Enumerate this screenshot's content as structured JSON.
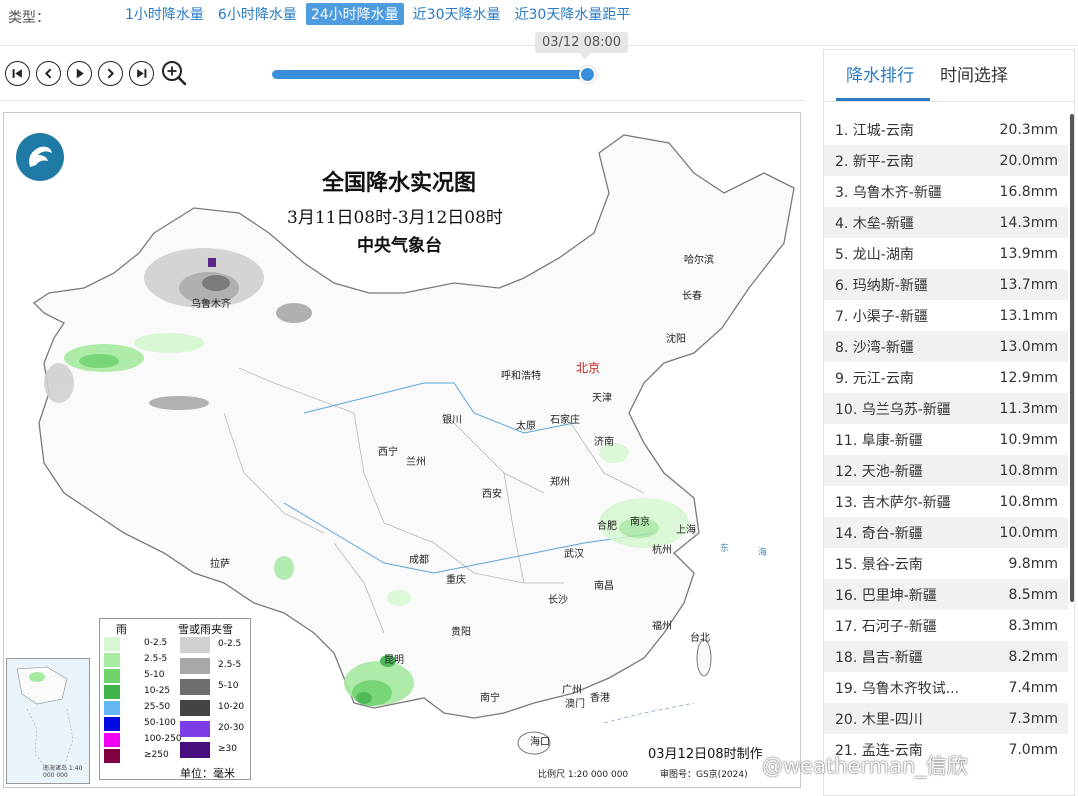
{
  "typebar": {
    "label": "类型：",
    "tabs": [
      "1小时降水量",
      "6小时降水量",
      "24小时降水量",
      "近30天降水量",
      "近30天降水量距平"
    ],
    "active_index": 2
  },
  "player": {
    "time_label": "03/12 08:00",
    "progress": 1.0,
    "controls": [
      "first-frame-icon",
      "prev-frame-icon",
      "play-icon",
      "next-frame-icon",
      "last-frame-icon",
      "zoom-in-icon"
    ]
  },
  "map": {
    "title": "全国降水实况图",
    "subtitle": "3月11日08时-3月12日08时",
    "org": "中央气象台",
    "cities": {
      "urumqi": "乌鲁木齐",
      "harbin": "哈尔滨",
      "changchun": "长春",
      "shenyang": "沈阳",
      "hohhot": "呼和浩特",
      "beijing": "北京",
      "tianjin": "天津",
      "yinchuan": "银川",
      "taiyuan": "太原",
      "shijiazhuang": "石家庄",
      "jinan": "济南",
      "xining": "西宁",
      "lanzhou": "兰州",
      "zhengzhou": "郑州",
      "xian": "西安",
      "hefei": "合肥",
      "nanjing": "南京",
      "shanghai": "上海",
      "hangzhou": "杭州",
      "lhasa": "拉萨",
      "chengdu": "成都",
      "wuhan": "武汉",
      "chongqing": "重庆",
      "nanchang": "南昌",
      "changsha": "长沙",
      "guiyang": "贵阳",
      "fuzhou": "福州",
      "taipei": "台北",
      "kunming": "昆明",
      "guangzhou": "广州",
      "nanning": "南宁",
      "hongkong": "香港",
      "macau": "澳门",
      "haikou": "海口"
    },
    "seas": {
      "east": "东",
      "sea": "海"
    },
    "legend": {
      "rain_header": "雨",
      "snow_header": "雪或雨夹雪",
      "rain_levels": [
        "0-2.5",
        "2.5-5",
        "5-10",
        "10-25",
        "25-50",
        "50-100",
        "100-250",
        "≥250"
      ],
      "rain_colors": [
        "#d7f7d2",
        "#a6e9a0",
        "#6cd36a",
        "#3eb44a",
        "#64b8f2",
        "#0008e0",
        "#f200f2",
        "#800040"
      ],
      "snow_levels": [
        "0-2.5",
        "2.5-5",
        "5-10",
        "10-20",
        "20-30",
        "≥30"
      ],
      "snow_colors": [
        "#d0d0d0",
        "#a8a8a8",
        "#6e6e6e",
        "#444444",
        "#7c3ce6",
        "#4a0f7e"
      ],
      "unit": "单位：毫米"
    },
    "made_time": "03月12日08时制作",
    "scale": "比例尺 1:20 000 000",
    "approval": "审图号：GS京(2024)",
    "inset_text": "南海诸岛 1:40 000 000"
  },
  "panel": {
    "tabs": [
      "降水排行",
      "时间选择"
    ],
    "active_tab": 0,
    "ranking": [
      {
        "name": "1. 江城-云南",
        "value": "20.3mm"
      },
      {
        "name": "2. 新平-云南",
        "value": "20.0mm"
      },
      {
        "name": "3. 乌鲁木齐-新疆",
        "value": "16.8mm"
      },
      {
        "name": "4. 木垒-新疆",
        "value": "14.3mm"
      },
      {
        "name": "5. 龙山-湖南",
        "value": "13.9mm"
      },
      {
        "name": "6. 玛纳斯-新疆",
        "value": "13.7mm"
      },
      {
        "name": "7. 小渠子-新疆",
        "value": "13.1mm"
      },
      {
        "name": "8. 沙湾-新疆",
        "value": "13.0mm"
      },
      {
        "name": "9. 元江-云南",
        "value": "12.9mm"
      },
      {
        "name": "10. 乌兰乌苏-新疆",
        "value": "11.3mm"
      },
      {
        "name": "11. 阜康-新疆",
        "value": "10.9mm"
      },
      {
        "name": "12. 天池-新疆",
        "value": "10.8mm"
      },
      {
        "name": "13. 吉木萨尔-新疆",
        "value": "10.8mm"
      },
      {
        "name": "14. 奇台-新疆",
        "value": "10.0mm"
      },
      {
        "name": "15. 景谷-云南",
        "value": "9.8mm"
      },
      {
        "name": "16. 巴里坤-新疆",
        "value": "8.5mm"
      },
      {
        "name": "17. 石河子-新疆",
        "value": "8.3mm"
      },
      {
        "name": "18. 昌吉-新疆",
        "value": "8.2mm"
      },
      {
        "name": "19. 乌鲁木齐牧试...",
        "value": "7.4mm"
      },
      {
        "name": "20. 木里-四川",
        "value": "7.3mm"
      },
      {
        "name": "21. 孟连-云南",
        "value": "7.0mm"
      }
    ]
  },
  "watermark": "@weatherman_信欣"
}
